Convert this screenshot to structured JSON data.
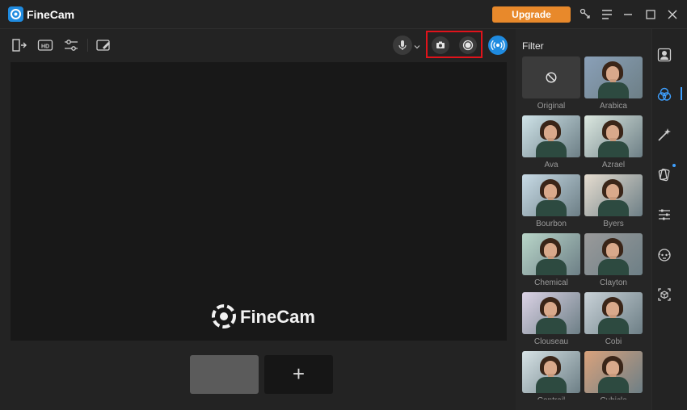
{
  "app": {
    "title": "FineCam",
    "upgrade_label": "Upgrade"
  },
  "toolbar": {
    "icons": [
      "export-icon",
      "hd-icon",
      "adjust-icon",
      "whiteboard-icon",
      "microphone-icon",
      "camera-icon",
      "record-icon",
      "live-icon"
    ],
    "hd_label": "HD"
  },
  "preview": {
    "watermark": "FineCam"
  },
  "scenes": {
    "add_label": "+"
  },
  "filter_panel": {
    "title": "Filter",
    "items": [
      {
        "label": "Original",
        "tint": "none"
      },
      {
        "label": "Arabica",
        "tint": "#8aa0b8"
      },
      {
        "label": "Ava",
        "tint": "#cfe3e8"
      },
      {
        "label": "Azrael",
        "tint": "#dce8e0"
      },
      {
        "label": "Bourbon",
        "tint": "#c8dbe6"
      },
      {
        "label": "Byers",
        "tint": "#e6ddd0"
      },
      {
        "label": "Chemical",
        "tint": "#b9d6c9"
      },
      {
        "label": "Clayton",
        "tint": "#9a9a9a"
      },
      {
        "label": "Clouseau",
        "tint": "#dcd3e6"
      },
      {
        "label": "Cobi",
        "tint": "#c9d2d8"
      },
      {
        "label": "Contrail",
        "tint": "#d7e3e6"
      },
      {
        "label": "Cubicle",
        "tint": "#d9a27c"
      }
    ]
  },
  "rail": {
    "icons": [
      "portrait-icon",
      "filter-icon",
      "magic-wand-icon",
      "sticker-icon",
      "settings-sliders-icon",
      "avatar-icon",
      "ar-cube-icon"
    ],
    "active_index": 1
  },
  "colors": {
    "accent": "#1f8be0",
    "upgrade": "#e8892b",
    "highlight": "#e0131b",
    "background": "#232323"
  }
}
